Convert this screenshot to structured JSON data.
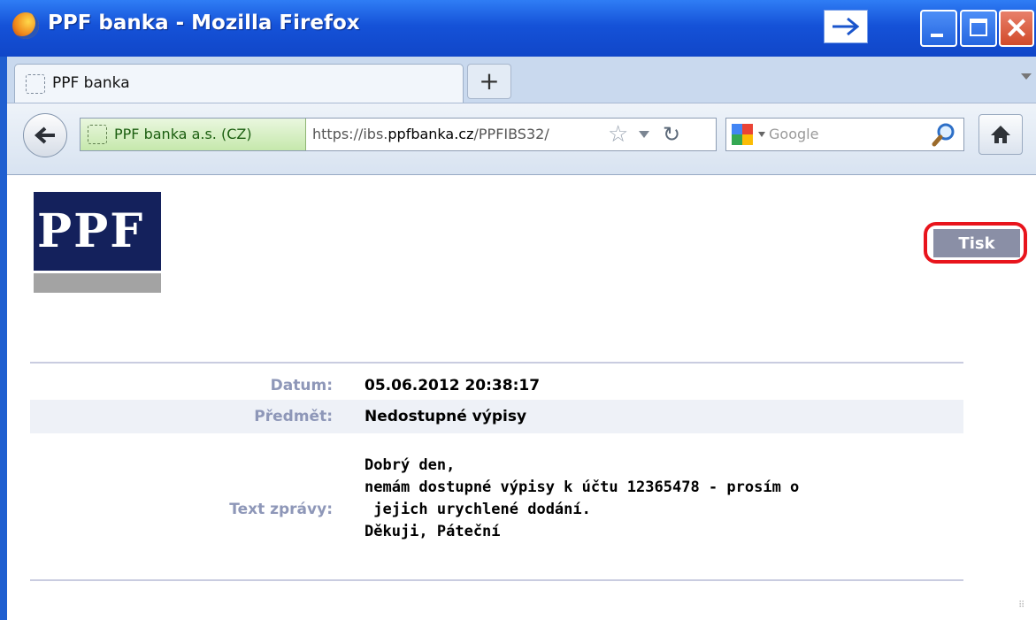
{
  "window": {
    "title": "PPF banka - Mozilla Firefox"
  },
  "tabs": [
    {
      "label": "PPF banka"
    }
  ],
  "navbar": {
    "identity_label": "PPF banka a.s. (CZ)",
    "url_prefix": "https://ibs.",
    "url_domain": "ppfbanka.cz",
    "url_path": "/PPFIBS32/",
    "search_placeholder": "Google"
  },
  "page": {
    "logo_text": "PPF",
    "print_button": "Tisk",
    "fields": {
      "date_label": "Datum:",
      "date_value": "05.06.2012 20:38:17",
      "subject_label": "Předmět:",
      "subject_value": "Nedostupné výpisy",
      "message_label": "Text zprávy:",
      "message_lines": [
        "Dobrý den,",
        "nemám dostupné výpisy k účtu 12365478 - prosím o",
        " jejich urychlené dodání.",
        "Děkuji, Páteční"
      ]
    }
  },
  "colors": {
    "titlebar": "#1552d8",
    "identity_bg": "#c6e8ac",
    "logo_blue": "#14215c",
    "print_button": "#8a8fa6",
    "highlight_ring": "#e8141c",
    "label_color": "#8e97b8"
  },
  "icons": {
    "app": "firefox-logo-icon",
    "go": "go-arrow-icon",
    "back": "back-arrow-icon",
    "bookmark": "star-icon",
    "reload": "reload-icon",
    "search_engine": "google-icon",
    "search": "magnifier-icon",
    "home": "home-icon"
  }
}
